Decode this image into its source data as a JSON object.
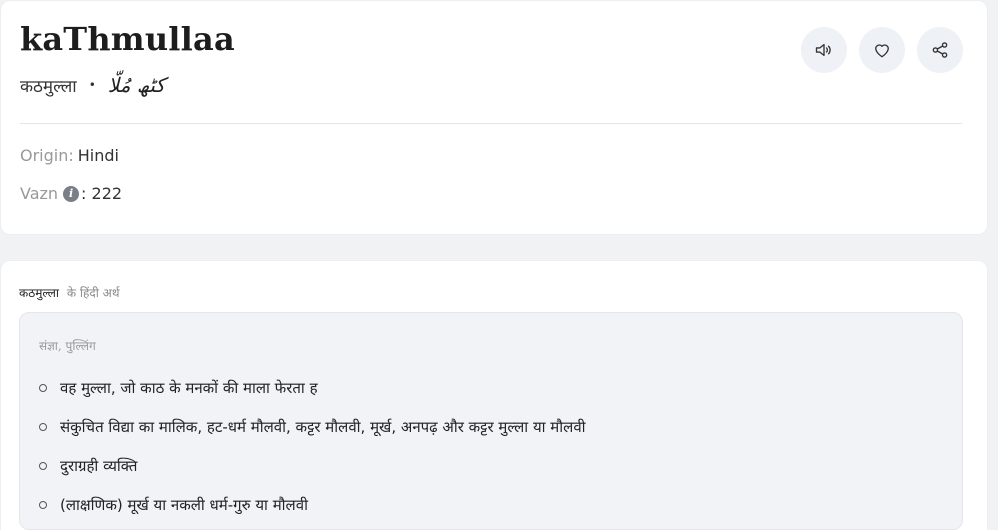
{
  "word": {
    "roman": "kaThmullaa",
    "hindi": "कठमुल्ला",
    "separator": "•",
    "urdu": "کٹھ مُلّا"
  },
  "actions": [
    {
      "name": "audio-button",
      "icon": "speaker-icon"
    },
    {
      "name": "favorite-button",
      "icon": "heart-icon"
    },
    {
      "name": "share-button",
      "icon": "share-icon"
    }
  ],
  "meta": {
    "origin_label": "Origin:",
    "origin_value": "Hindi",
    "vazn_label": "Vazn",
    "vazn_info_icon": "i",
    "vazn_value": ": 222"
  },
  "meaning": {
    "heading_word": "कठमुल्ला",
    "heading_rest": "के हिंदी अर्थ",
    "part_of_speech": "संज्ञा, पुल्लिंग",
    "items": [
      "वह मुल्ला, जो काठ के मनकों की माला फेरता ह",
      "संकुचित विद्या का मालिक, हट-धर्म मौलवी, कट्टर मौलवी, मूर्ख, अनपढ़ और कट्टर मुल्ला या मौलवी",
      "दुराग्रही व्यक्ति",
      "(लाक्षणिक) मूर्ख या नकली धर्म-गुरु या मौलवी"
    ]
  },
  "colors": {
    "page_bg": "#f1f2f4",
    "card_bg": "#ffffff",
    "meaning_box_bg": "#f1f3f7",
    "action_btn_bg": "#eef1f5"
  }
}
